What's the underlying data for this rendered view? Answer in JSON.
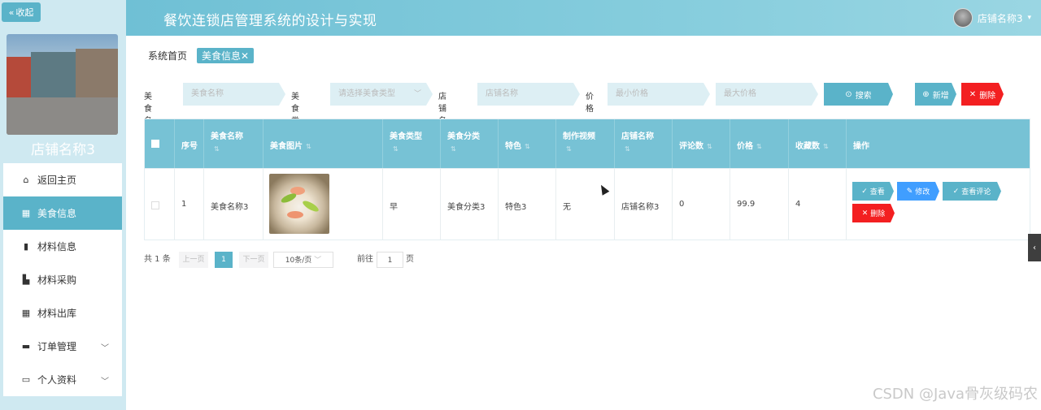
{
  "sidebar": {
    "collapse_label": "收起",
    "store_name": "店铺名称3",
    "items": [
      {
        "label": "返回主页",
        "icon": "home-icon"
      },
      {
        "label": "美食信息",
        "icon": "grid-icon"
      },
      {
        "label": "材料信息",
        "icon": "document-icon"
      },
      {
        "label": "材料采购",
        "icon": "cart-icon"
      },
      {
        "label": "材料出库",
        "icon": "grid-icon"
      },
      {
        "label": "订单管理",
        "icon": "briefcase-icon"
      },
      {
        "label": "个人资料",
        "icon": "card-icon"
      }
    ]
  },
  "header": {
    "title": "餐饮连锁店管理系统的设计与实现",
    "user_name": "店铺名称3"
  },
  "breadcrumb": {
    "home": "系统首页",
    "current": "美食信息"
  },
  "search": {
    "food_name_label": "美食名称",
    "food_name_placeholder": "美食名称",
    "food_type_label": "美食类型",
    "food_type_placeholder": "请选择美食类型",
    "store_label": "店铺名称",
    "store_placeholder": "店铺名称",
    "price_label": "价格",
    "min_price_placeholder": "最小价格",
    "max_price_placeholder": "最大价格",
    "search_button": "搜索",
    "add_button": "新增",
    "delete_button": "删除"
  },
  "table": {
    "headers": [
      "序号",
      "美食名称",
      "美食图片",
      "美食类型",
      "美食分类",
      "特色",
      "制作视频",
      "店铺名称",
      "评论数",
      "价格",
      "收藏数",
      "操作"
    ],
    "rows": [
      {
        "index": "1",
        "name": "美食名称3",
        "type": "早",
        "category": "美食分类3",
        "feature": "特色3",
        "video": "无",
        "store": "店铺名称3",
        "comments": "0",
        "price": "99.9",
        "favorites": "4"
      }
    ],
    "row_actions": {
      "view": "查看",
      "edit": "修改",
      "view_comments": "查看评论",
      "delete": "删除"
    }
  },
  "pagination": {
    "total": "共 1 条",
    "prev": "上一页",
    "current_page": "1",
    "next": "下一页",
    "page_size": "10条/页",
    "goto_label": "前往",
    "goto_value": "1",
    "page_suffix": "页"
  },
  "watermark": "CSDN @Java骨灰级码农",
  "colors": {
    "accent": "#5ab3c9",
    "header_bg": "#77c2d5",
    "danger": "#f31f21",
    "edit_blue": "#409eff"
  }
}
